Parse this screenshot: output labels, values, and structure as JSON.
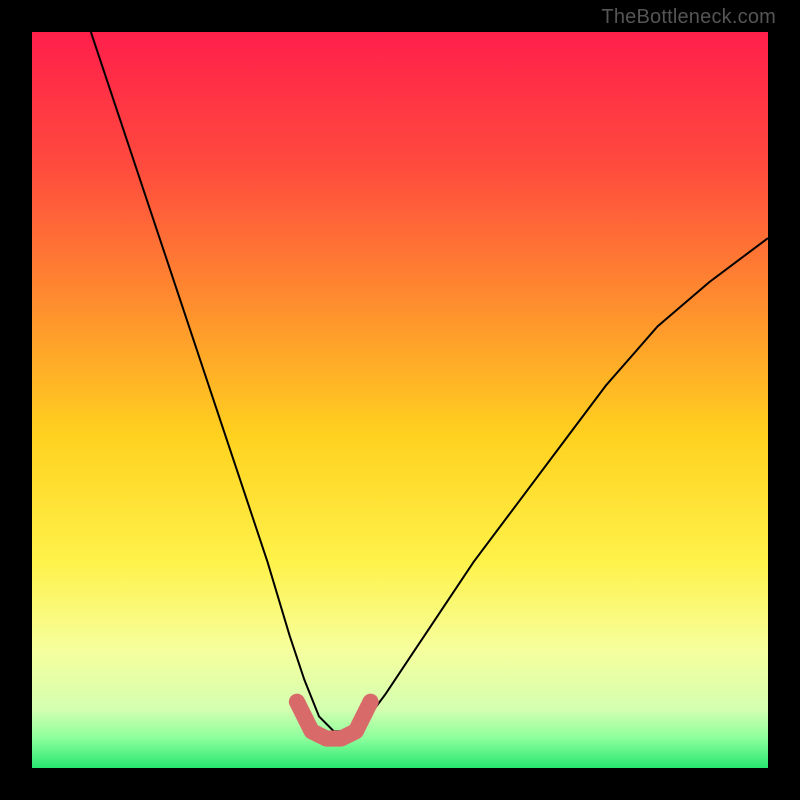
{
  "watermark": "TheBottleneck.com",
  "chart_data": {
    "type": "line",
    "title": "",
    "xlabel": "",
    "ylabel": "",
    "xlim": [
      0,
      100
    ],
    "ylim": [
      0,
      100
    ],
    "series": [
      {
        "name": "bottleneck-curve",
        "x": [
          8,
          12,
          16,
          20,
          24,
          28,
          32,
          35,
          37,
          39,
          41,
          43,
          45,
          48,
          52,
          56,
          60,
          66,
          72,
          78,
          85,
          92,
          100
        ],
        "y": [
          100,
          88,
          76,
          64,
          52,
          40,
          28,
          18,
          12,
          7,
          5,
          5,
          6,
          10,
          16,
          22,
          28,
          36,
          44,
          52,
          60,
          66,
          72
        ]
      }
    ],
    "marker_segment": {
      "name": "highlight-bottom",
      "x": [
        36,
        38,
        40,
        42,
        44,
        46
      ],
      "y": [
        9,
        5,
        4,
        4,
        5,
        9
      ]
    },
    "background_gradient_stops": [
      {
        "offset": 0.0,
        "color": "#ff1f4b"
      },
      {
        "offset": 0.18,
        "color": "#ff4a3e"
      },
      {
        "offset": 0.36,
        "color": "#ff8a2f"
      },
      {
        "offset": 0.55,
        "color": "#ffd21f"
      },
      {
        "offset": 0.72,
        "color": "#fff24a"
      },
      {
        "offset": 0.84,
        "color": "#f6ff9e"
      },
      {
        "offset": 0.92,
        "color": "#d4ffb0"
      },
      {
        "offset": 0.96,
        "color": "#8bff9c"
      },
      {
        "offset": 1.0,
        "color": "#28e56f"
      }
    ],
    "curve_color": "#000000",
    "marker_color": "#d86a6a"
  }
}
